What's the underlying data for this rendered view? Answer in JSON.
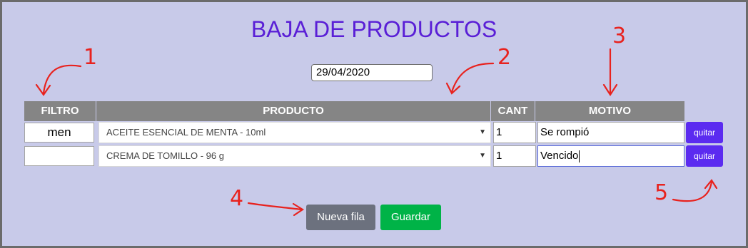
{
  "page": {
    "title": "BAJA DE PRODUCTOS"
  },
  "form": {
    "date": "29/04/2020"
  },
  "table": {
    "headers": [
      "FILTRO",
      "PRODUCTO",
      "CANT",
      "MOTIVO"
    ],
    "rows": [
      {
        "filtro": "men",
        "producto": "ACEITE ESENCIAL DE MENTA - 10ml",
        "cant": "1",
        "motivo": "Se rompió",
        "action": "quitar"
      },
      {
        "filtro": "",
        "producto": "CREMA DE TOMILLO - 96 g",
        "cant": "1",
        "motivo": "Vencido",
        "action": "quitar"
      }
    ]
  },
  "buttons": {
    "new_row": "Nueva fila",
    "save": "Guardar"
  },
  "annotations": [
    "1",
    "2",
    "3",
    "4",
    "5"
  ],
  "colors": {
    "background": "#c8cae9",
    "title": "#5a1fd6",
    "header": "#858585",
    "remove": "#5b2bf0",
    "save": "#00b347",
    "annotation": "#e8221e"
  },
  "icons": {
    "select": "chevron-down-icon"
  }
}
